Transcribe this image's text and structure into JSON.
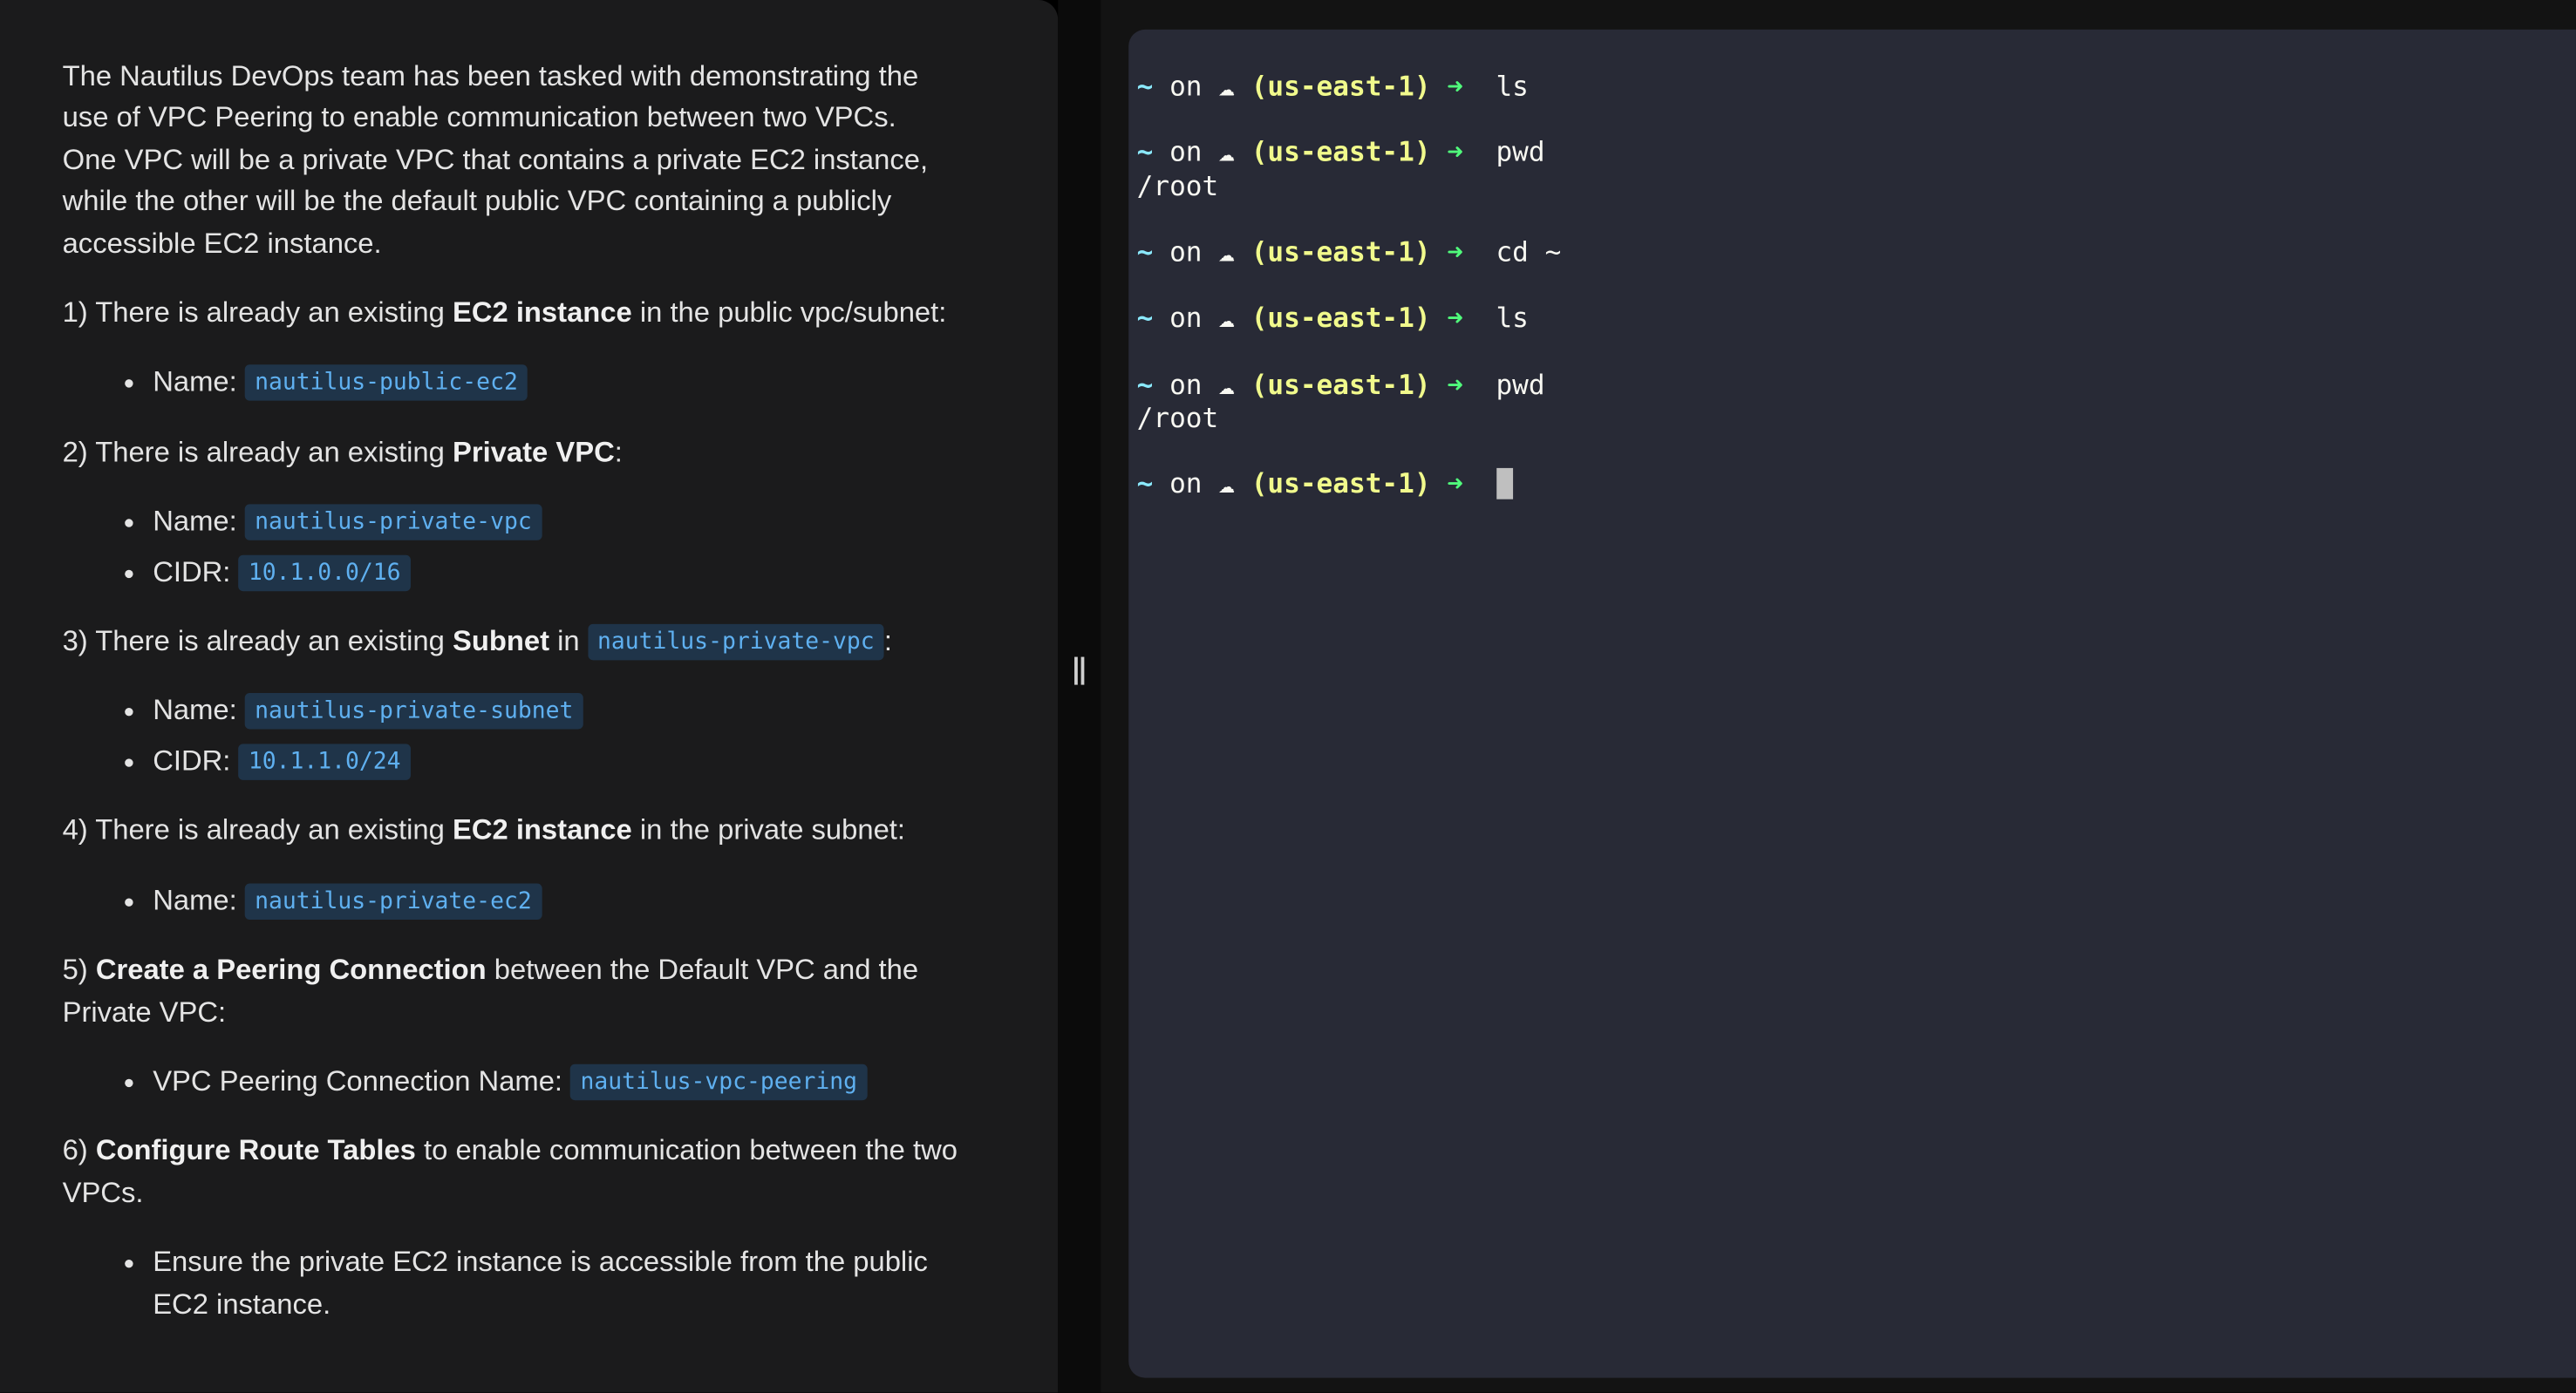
{
  "instructions": {
    "intro": "The Nautilus DevOps team has been tasked with demonstrating the use of VPC Peering to enable communication between two VPCs. One VPC will be a private VPC that contains a private EC2 instance, while the other will be the default public VPC containing a publicly accessible EC2 instance.",
    "step1": {
      "prefix": "1) There is already an existing ",
      "bold": "EC2 instance",
      "suffix": " in the public vpc/subnet:",
      "items": [
        {
          "label": "Name: ",
          "code": "nautilus-public-ec2"
        }
      ]
    },
    "step2": {
      "prefix": "2) There is already an existing ",
      "bold": "Private VPC",
      "suffix": ":",
      "items": [
        {
          "label": "Name: ",
          "code": "nautilus-private-vpc"
        },
        {
          "label": "CIDR: ",
          "code": "10.1.0.0/16"
        }
      ]
    },
    "step3": {
      "prefix": "3) There is already an existing ",
      "bold": "Subnet",
      "middle": " in ",
      "code": "nautilus-private-vpc",
      "suffix": ":",
      "items": [
        {
          "label": "Name: ",
          "code": "nautilus-private-subnet"
        },
        {
          "label": "CIDR: ",
          "code": "10.1.1.0/24"
        }
      ]
    },
    "step4": {
      "prefix": "4) There is already an existing ",
      "bold": "EC2 instance",
      "suffix": " in the private subnet:",
      "items": [
        {
          "label": "Name: ",
          "code": "nautilus-private-ec2"
        }
      ]
    },
    "step5": {
      "prefix": "5) ",
      "bold": "Create a Peering Connection",
      "suffix": " between the Default VPC and the Private VPC:",
      "items": [
        {
          "label": "VPC Peering Connection Name: ",
          "code": "nautilus-vpc-peering"
        }
      ]
    },
    "step6": {
      "prefix": "6) ",
      "bold": "Configure Route Tables",
      "suffix": " to enable communication between the two VPCs.",
      "items": [
        {
          "label": "Ensure the private EC2 instance is accessible from the public EC2 instance."
        }
      ]
    }
  },
  "divider": {
    "icon": "drag-handle-icon"
  },
  "terminal": {
    "prompt": {
      "tilde": "~",
      "on": " on ",
      "cloud": "☁",
      "region": " (us-east-1)",
      "arrow": " ➜ "
    },
    "commands": [
      "ls",
      "pwd",
      "cd ~",
      "ls",
      "pwd"
    ],
    "outputs": {
      "pwd1": "/root",
      "pwd2": "/root"
    },
    "colors": {
      "background": "#282a36",
      "tilde": "#8be9fd",
      "region": "#f1fa8c",
      "arrow": "#50fa7b"
    }
  }
}
